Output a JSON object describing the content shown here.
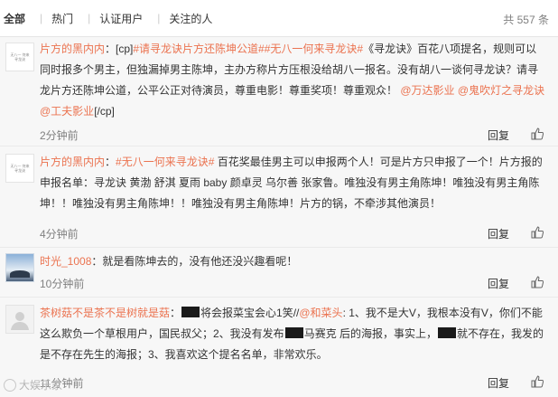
{
  "tabs": {
    "all": "全部",
    "hot": "热门",
    "verified": "认证用户",
    "following": "关注的人"
  },
  "total_count": "共 557 条",
  "avatar_text": "无八一 何来 寻龙诀",
  "comments": [
    {
      "user": "片方的黑内内",
      "sep": "：",
      "parts": [
        "[cp]",
        "#请寻龙诀片方还陈坤公道#",
        "#无八一何来寻龙诀#",
        "《寻龙诀》百花八项提名，规则可以同时报多个男主，但独漏掉男主陈坤，主办方称片方压根没给胡八一报名。没有胡八一谈何寻龙诀？请寻龙片方还陈坤公道，公平公正对待演员，尊重电影！尊重奖项！尊重观众！",
        "@万达影业",
        "@鬼吹灯之寻龙诀",
        "@工夫影业",
        "[/cp]"
      ],
      "time": "2分钟前",
      "reply": "回复"
    },
    {
      "user": "片方的黑内内",
      "sep": "：",
      "parts": [
        "#无八一何来寻龙诀#",
        " 百花奖最佳男主可以申报两个人！可是片方只申报了一个！片方报的申报名单：寻龙诀 黄渤 舒淇 夏雨 baby 颜卓灵 乌尔善 张家鲁。唯独没有男主角陈坤！唯独没有男主角陈坤！！唯独没有男主角陈坤！！唯独没有男主角陈坤！片方的锅，不牵涉其他演员！"
      ],
      "time": "4分钟前",
      "reply": "回复"
    },
    {
      "user": "时光_1008",
      "sep": "：",
      "parts": [
        "就是看陈坤去的，没有他还没兴趣看呢！"
      ],
      "time": "10分钟前",
      "reply": "回复"
    },
    {
      "user": "茶树菇不是茶不是树就是菇",
      "sep": "：",
      "parts": [
        "将会报菜宝会心1笑//",
        "@和菜头",
        ": 1、我不是大V，我根本没有V，你们不能这么欺负一个草根用户，国民叔父；2、我没有发布",
        "马赛克 后的海报，事实上，",
        "就不存在，我发的是不存在先生的海报；3、我喜欢这个提名名单，非常欢乐。"
      ],
      "time": "11分钟前",
      "reply": "回复"
    }
  ],
  "watermark": "大娱乐家"
}
